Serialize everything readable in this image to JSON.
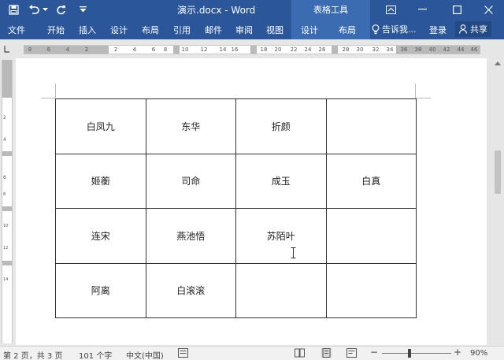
{
  "window": {
    "title": "演示.docx - Word",
    "context_tab_title": "表格工具"
  },
  "ribbon": {
    "tabs": [
      "文件",
      "开始",
      "插入",
      "设计",
      "布局",
      "引用",
      "邮件",
      "审阅",
      "视图",
      "设计",
      "布局"
    ],
    "tell_me": "告诉我...",
    "login": "登录",
    "share": "共享"
  },
  "ruler": {
    "ticks": [
      "8",
      "6",
      "4",
      "2",
      "2",
      "4",
      "6",
      "8",
      "10",
      "12",
      "14",
      "16",
      "18",
      "20",
      "22",
      "24",
      "26",
      "28",
      "30",
      "32",
      "34",
      "36",
      "38",
      "40",
      "42",
      "44",
      "46"
    ],
    "vticks": [
      "2",
      "4",
      "6",
      "8",
      "10",
      "12",
      "14"
    ]
  },
  "table": {
    "rows": [
      [
        "白凤九",
        "东华",
        "折颜",
        ""
      ],
      [
        "姬蘅",
        "司命",
        "成玉",
        "白真"
      ],
      [
        "连宋",
        "燕池悟",
        "苏陌叶",
        ""
      ],
      [
        "阿离",
        "白滚滚",
        "",
        ""
      ]
    ]
  },
  "status": {
    "page": "第 2 页，共 3 页",
    "words": "101 个字",
    "language": "中文(中国)",
    "zoom": "90%"
  },
  "colors": {
    "ribbon": "#2b579a",
    "context_tab": "#3b6bb1"
  }
}
